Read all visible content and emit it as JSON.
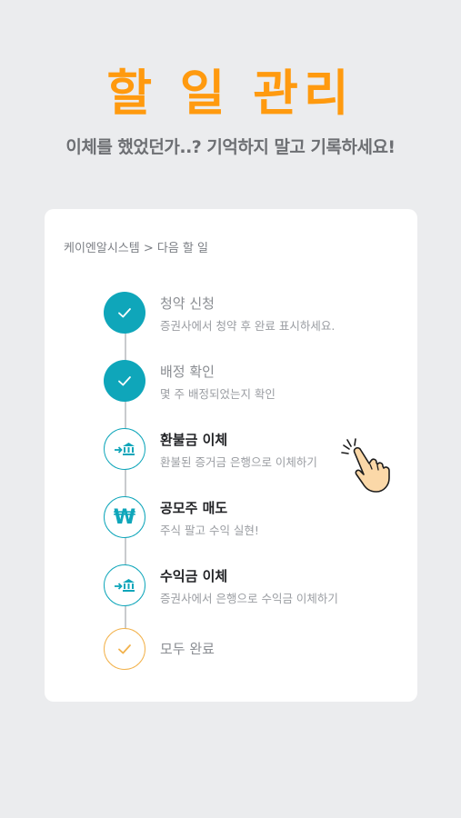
{
  "hero": {
    "title": "할 일 관리",
    "subtitle": "이체를 했었던가..? 기억하지 말고 기록하세요!"
  },
  "card": {
    "breadcrumb": "케이엔알시스템 > 다음 할 일",
    "steps": [
      {
        "title": "청약 신청",
        "description": "증권사에서 청약 후 완료 표시하세요.",
        "status": "done",
        "icon": "check-icon"
      },
      {
        "title": "배정 확인",
        "description": "몇 주 배정되었는지 확인",
        "status": "done",
        "icon": "check-icon"
      },
      {
        "title": "환불금 이체",
        "description": "환불된 증거금 은행으로 이체하기",
        "status": "pending",
        "icon": "bank-transfer-icon"
      },
      {
        "title": "공모주 매도",
        "description": "주식 팔고 수익 실현!",
        "status": "pending",
        "icon": "won-icon",
        "icon_glyph": "₩"
      },
      {
        "title": "수익금 이체",
        "description": "증권사에서 은행으로 수익금 이체하기",
        "status": "pending",
        "icon": "bank-transfer-icon"
      },
      {
        "title": "모두 완료",
        "description": "",
        "status": "final",
        "icon": "check-icon"
      }
    ]
  },
  "colors": {
    "accent": "#ff9a0f",
    "teal": "#0fa6ba",
    "final": "#f2b24c",
    "background": "#ebecee"
  }
}
